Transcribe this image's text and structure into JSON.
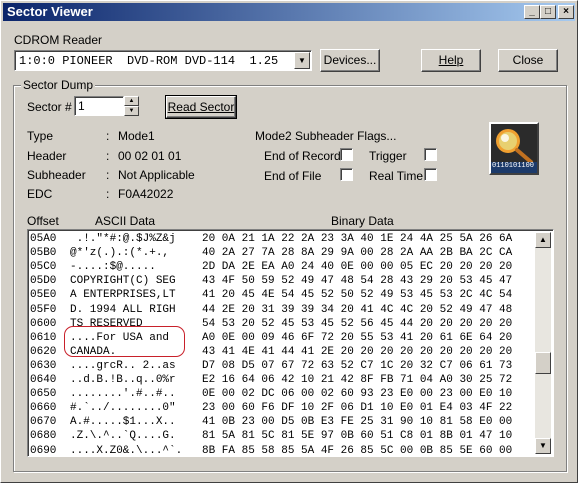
{
  "window": {
    "title": "Sector Viewer"
  },
  "cdrom": {
    "label": "CDROM Reader",
    "selected": "1:0:0 PIONEER  DVD-ROM DVD-114  1.25",
    "devices_label": "Devices...",
    "help_label": "Help",
    "close_label": "Close"
  },
  "dump": {
    "group_label": "Sector Dump",
    "sector_label": "Sector #",
    "sector_value": "1",
    "read_label": "Read Sector"
  },
  "info": {
    "type_label": "Type",
    "type_value": "Mode1",
    "header_label": "Header",
    "header_value": "00 02 01 01",
    "subheader_label": "Subheader",
    "subheader_value": "Not Applicable",
    "edc_label": "EDC",
    "edc_value": "F0A42022",
    "colon": ":"
  },
  "flags": {
    "title": "Mode2 Subheader Flags...",
    "end_of_record": "End of Record",
    "trigger": "Trigger",
    "end_of_file": "End of File",
    "real_time": "Real Time"
  },
  "icon": {
    "name": "magnifier-binary-icon",
    "binary_text": "0110101100"
  },
  "columns": {
    "offset": "Offset",
    "ascii": "ASCII Data",
    "binary": "Binary Data"
  },
  "rows": [
    {
      "offset": "05A0",
      "ascii": " .!.\"*#:@.$J%Z&j",
      "binary": "20 0A 21 1A 22 2A 23 3A 40 1E 24 4A 25 5A 26 6A"
    },
    {
      "offset": "05B0",
      "ascii": "@*'z(.).:(*.+.,",
      "binary": "40 2A 27 7A 28 8A 29 9A 00 28 2A AA 2B BA 2C CA"
    },
    {
      "offset": "05C0",
      "ascii": "-....:$@.....",
      "binary": "2D DA 2E EA A0 24 40 0E 00 00 05 EC 20 20 20 20"
    },
    {
      "offset": "05D0",
      "ascii": "COPYRIGHT(C) SEG",
      "binary": "43 4F 50 59 52 49 47 48 54 28 43 29 20 53 45 47"
    },
    {
      "offset": "05E0",
      "ascii": "A ENTERPRISES,LT",
      "binary": "41 20 45 4E 54 45 52 50 52 49 53 45 53 2C 4C 54"
    },
    {
      "offset": "05F0",
      "ascii": "D. 1994 ALL RIGH",
      "binary": "44 2E 20 31 39 39 34 20 41 4C 4C 20 52 49 47 48"
    },
    {
      "offset": "0600",
      "ascii": "TS RESERVED",
      "binary": "54 53 20 52 45 53 45 52 56 45 44 20 20 20 20 20"
    },
    {
      "offset": "0610",
      "ascii": "....For USA and",
      "binary": "A0 0E 00 09 46 6F 72 20 55 53 41 20 61 6E 64 20"
    },
    {
      "offset": "0620",
      "ascii": "CANADA.",
      "binary": "43 41 4E 41 44 41 2E 20 20 20 20 20 20 20 20 20"
    },
    {
      "offset": "0630",
      "ascii": "....grcR.. 2..as",
      "binary": "D7 08 D5 07 67 72 63 52 C7 1C 20 32 C7 06 61 73"
    },
    {
      "offset": "0640",
      "ascii": "..d.B.!B..q..0%r",
      "binary": "E2 16 64 06 42 10 21 42 8F FB 71 04 A0 30 25 72"
    },
    {
      "offset": "0650",
      "ascii": "........'.#..#..",
      "binary": "0E 00 02 DC 06 00 02 60 93 23 E0 00 23 00 E0 10"
    },
    {
      "offset": "0660",
      "ascii": "#.`../........0\"",
      "binary": "23 00 60 F6 DF 10 2F 06 D1 10 E0 01 E4 03 4F 22"
    },
    {
      "offset": "0670",
      "ascii": "A.#.....$1...X..",
      "binary": "41 0B 23 00 D5 0B E3 FE 25 31 90 10 81 58 E0 00"
    },
    {
      "offset": "0680",
      "ascii": ".Z.\\.^..`Q....G.",
      "binary": "81 5A 81 5C 81 5E 97 0B 60 51 C8 01 8B 01 47 10"
    },
    {
      "offset": "0690",
      "ascii": "....X.Z0&.\\...^`.",
      "binary": "8B FA 85 58 85 5A 4F 26 85 5C 00 0B 85 5E 60 00"
    }
  ]
}
